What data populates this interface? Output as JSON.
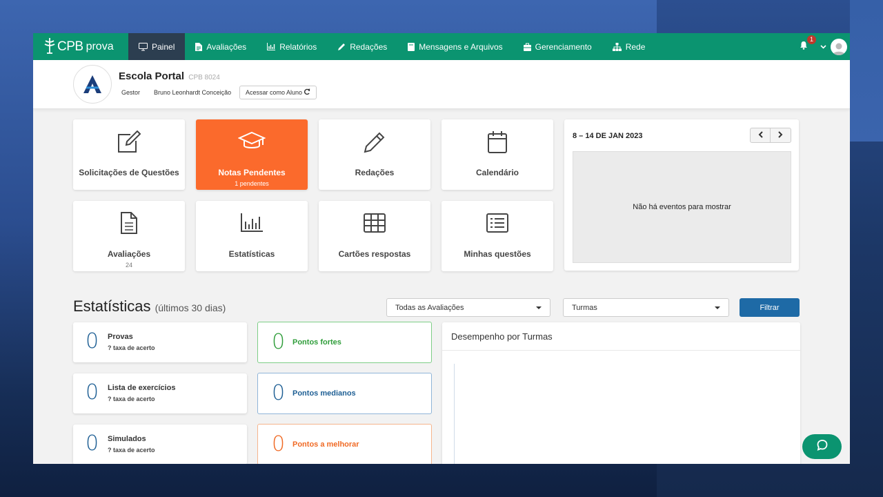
{
  "brand": {
    "name": "CPB",
    "suffix": "prova"
  },
  "nav": {
    "items": [
      {
        "label": "Painel",
        "icon": "monitor-icon",
        "active": true
      },
      {
        "label": "Avaliações",
        "icon": "document-icon"
      },
      {
        "label": "Relatórios",
        "icon": "bar-chart-icon"
      },
      {
        "label": "Redações",
        "icon": "pencil-icon"
      },
      {
        "label": "Mensagens e Arquivos",
        "icon": "book-icon"
      },
      {
        "label": "Gerenciamento",
        "icon": "briefcase-icon"
      },
      {
        "label": "Rede",
        "icon": "sitemap-icon"
      }
    ],
    "notifications_count": "1"
  },
  "school": {
    "name": "Escola Portal",
    "code": "CPB 8024",
    "role": "Gestor",
    "user": "Bruno Leonhardt Conceição",
    "access_button": "Acessar como Aluno"
  },
  "tiles": [
    {
      "label": "Solicitações de Questões",
      "sub": "",
      "icon": "edit-icon"
    },
    {
      "label": "Notas Pendentes",
      "sub": "1 pendentes",
      "icon": "graduation-cap-icon",
      "highlight": "#fb6a2c"
    },
    {
      "label": "Redações",
      "sub": "",
      "icon": "pencil-icon"
    },
    {
      "label": "Calendário",
      "sub": "",
      "icon": "calendar-icon"
    },
    {
      "label": "Avaliações",
      "sub": "24",
      "icon": "file-lines-icon"
    },
    {
      "label": "Estatísticas",
      "sub": "",
      "icon": "bar-chart-icon"
    },
    {
      "label": "Cartões respostas",
      "sub": "",
      "icon": "grid-icon"
    },
    {
      "label": "Minhas questões",
      "sub": "",
      "icon": "list-icon"
    }
  ],
  "calendar": {
    "range": "8 – 14 DE JAN 2023",
    "empty_message": "Não há eventos para mostrar"
  },
  "stats": {
    "title": "Estatísticas",
    "subtitle": "(últimos 30 dias)",
    "filter_assessments": "Todas as Avaliações",
    "filter_classes": "Turmas",
    "filter_button": "Filtrar",
    "cards": [
      {
        "value": "0",
        "label": "Provas",
        "sub": "? taxa de acerto"
      },
      {
        "value": "0",
        "label": "Lista de exercícios",
        "sub": "? taxa de acerto"
      },
      {
        "value": "0",
        "label": "Simulados",
        "sub": "? taxa de acerto"
      }
    ],
    "points": [
      {
        "value": "0",
        "label": "Pontos fortes",
        "color": "#2f9d3a"
      },
      {
        "value": "0",
        "label": "Pontos medianos",
        "color": "#1e5f94"
      },
      {
        "value": "0",
        "label": "Pontos a melhorar",
        "color": "#f06a25"
      }
    ],
    "performance_title": "Desempenho por Turmas"
  },
  "colors": {
    "brand_green": "#0b9470",
    "nav_active": "#2c3e50",
    "primary_blue": "#1e6aa6"
  }
}
